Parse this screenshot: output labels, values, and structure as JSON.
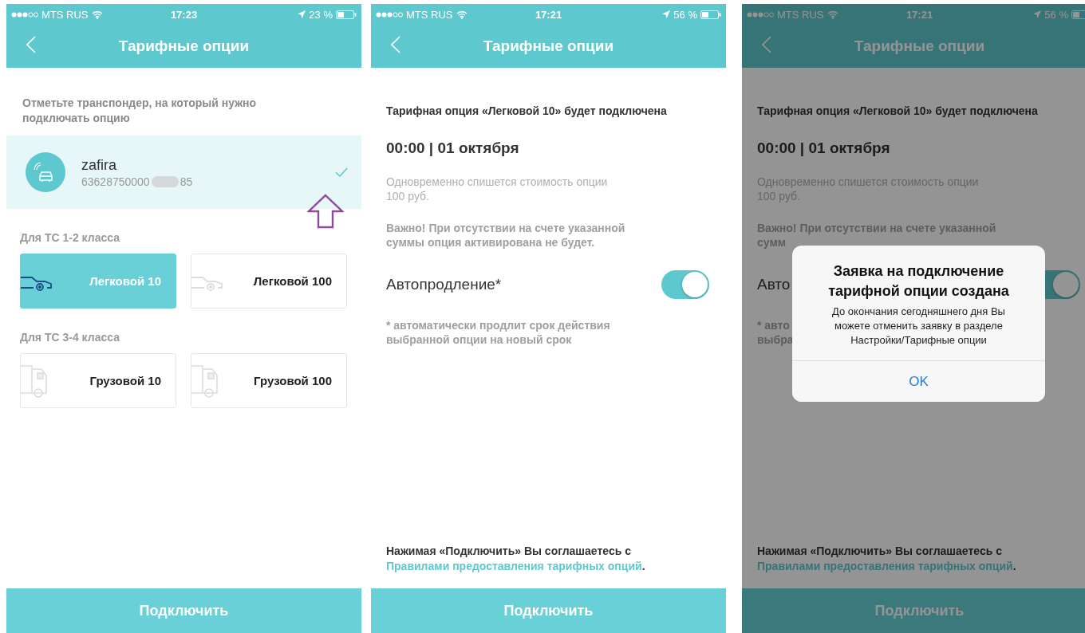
{
  "screens": [
    {
      "kind": "select",
      "status_bar": {
        "carrier": "MTS RUS",
        "time": "17:23",
        "battery": "23 %"
      },
      "title": "Тарифные опции",
      "hint": "Отметьте транспондер, на который нужно подключать опцию",
      "transponder": {
        "name": "zafira",
        "number": "63628750000",
        "number_tail": "85",
        "selected": true
      },
      "groups": [
        {
          "label": "Для ТС 1-2 класса",
          "options": [
            {
              "kind": "car",
              "label": "Легковой 10",
              "selected": true
            },
            {
              "kind": "car",
              "label": "Легковой 100",
              "selected": false
            }
          ]
        },
        {
          "label": "Для ТС 3-4 класса",
          "options": [
            {
              "kind": "truck",
              "label": "Грузовой 10",
              "selected": false
            },
            {
              "kind": "truck",
              "label": "Грузовой 100",
              "selected": false
            }
          ]
        }
      ],
      "button": "Подключить"
    },
    {
      "kind": "confirm",
      "status_bar": {
        "carrier": "MTS RUS",
        "time": "17:21",
        "battery": "56 %"
      },
      "title": "Тарифные опции",
      "notice": "Тарифная опция «Легковой 10» будет подключена",
      "date": "00:00 | 01 октября",
      "cost_lines": [
        "Одновременно спишется стоимость опции",
        "100 руб."
      ],
      "warning_lines": [
        "Важно! При отсутствии на счете указанной",
        "суммы опция активирована не будет."
      ],
      "autorenew": {
        "label": "Автопродление*",
        "on": true
      },
      "footnote_lines": [
        "* автоматически продлит срок действия",
        "выбранной опции на новый срок"
      ],
      "agreement": {
        "text": "Нажимая «Подключить» Вы соглашаетесь с",
        "link": "Правилами предоставления тарифных опций",
        "end": "."
      },
      "button": "Подключить"
    },
    {
      "kind": "confirm",
      "status_bar": {
        "carrier": "MTS RUS",
        "time": "17:21",
        "battery": "56 %"
      },
      "title": "Тарифные опции",
      "notice": "Тарифная опция «Легковой 10» будет подключена",
      "date": "00:00 | 01 октября",
      "cost_lines": [
        "Одновременно спишется стоимость опции",
        "100 руб."
      ],
      "warning_lines": [
        "Важно! При отсутствии на счете указанной",
        "сумм"
      ],
      "autorenew": {
        "label": "Авто",
        "on": true
      },
      "footnote_lines": [
        "* авто",
        "выбра"
      ],
      "agreement": {
        "text": "Нажимая «Подключить» Вы соглашаетесь с",
        "link": "Правилами предоставления тарифных опций",
        "end": "."
      },
      "button": "Подключить",
      "dialog": {
        "title": "Заявка на подключение тарифной опции создана",
        "message": "До окончания сегодняшнего дня Вы можете отменить заявку в разделе Настройки/Тарифные опции",
        "button": "OK"
      }
    }
  ]
}
